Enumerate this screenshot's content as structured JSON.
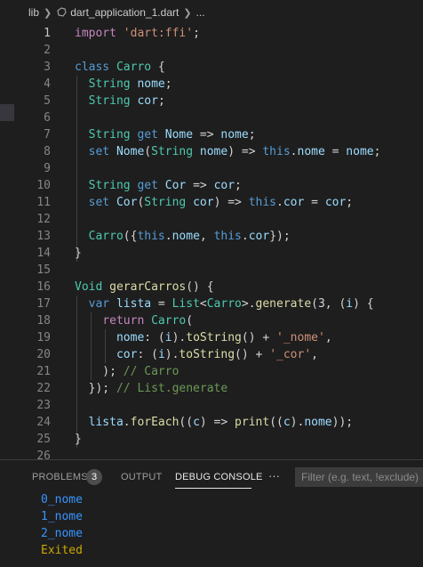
{
  "breadcrumb": {
    "folder": "lib",
    "file": "dart_application_1.dart",
    "tail": "..."
  },
  "lines": [
    {
      "n": "1"
    },
    {
      "n": "2"
    },
    {
      "n": "3"
    },
    {
      "n": "4"
    },
    {
      "n": "5"
    },
    {
      "n": "6"
    },
    {
      "n": "7"
    },
    {
      "n": "8"
    },
    {
      "n": "9"
    },
    {
      "n": "10"
    },
    {
      "n": "11"
    },
    {
      "n": "12"
    },
    {
      "n": "13"
    },
    {
      "n": "14"
    },
    {
      "n": "15"
    },
    {
      "n": "16"
    },
    {
      "n": "17"
    },
    {
      "n": "18"
    },
    {
      "n": "19"
    },
    {
      "n": "20"
    },
    {
      "n": "21"
    },
    {
      "n": "22"
    },
    {
      "n": "23"
    },
    {
      "n": "24"
    },
    {
      "n": "25"
    },
    {
      "n": "26"
    }
  ],
  "code": {
    "l1": [
      [
        "kw2",
        "import"
      ],
      [
        "pl",
        " "
      ],
      [
        "str",
        "'dart:ffi'"
      ],
      [
        "pl",
        ";"
      ]
    ],
    "l3": [
      [
        "kw",
        "class"
      ],
      [
        "pl",
        " "
      ],
      [
        "ty",
        "Carro"
      ],
      [
        "pl",
        " {"
      ]
    ],
    "l4": [
      [
        "pl",
        "  "
      ],
      [
        "ty",
        "String"
      ],
      [
        "pl",
        " "
      ],
      [
        "var",
        "nome"
      ],
      [
        "pl",
        ";"
      ]
    ],
    "l5": [
      [
        "pl",
        "  "
      ],
      [
        "ty",
        "String"
      ],
      [
        "pl",
        " "
      ],
      [
        "var",
        "cor"
      ],
      [
        "pl",
        ";"
      ]
    ],
    "l7": [
      [
        "pl",
        "  "
      ],
      [
        "ty",
        "String"
      ],
      [
        "pl",
        " "
      ],
      [
        "kw",
        "get"
      ],
      [
        "pl",
        " "
      ],
      [
        "var",
        "Nome"
      ],
      [
        "pl",
        " => "
      ],
      [
        "var",
        "nome"
      ],
      [
        "pl",
        ";"
      ]
    ],
    "l8": [
      [
        "pl",
        "  "
      ],
      [
        "kw",
        "set"
      ],
      [
        "pl",
        " "
      ],
      [
        "var",
        "Nome"
      ],
      [
        "pl",
        "("
      ],
      [
        "ty",
        "String"
      ],
      [
        "pl",
        " "
      ],
      [
        "var",
        "nome"
      ],
      [
        "pl",
        ") => "
      ],
      [
        "kw",
        "this"
      ],
      [
        "pl",
        "."
      ],
      [
        "var",
        "nome"
      ],
      [
        "pl",
        " = "
      ],
      [
        "var",
        "nome"
      ],
      [
        "pl",
        ";"
      ]
    ],
    "l10": [
      [
        "pl",
        "  "
      ],
      [
        "ty",
        "String"
      ],
      [
        "pl",
        " "
      ],
      [
        "kw",
        "get"
      ],
      [
        "pl",
        " "
      ],
      [
        "var",
        "Cor"
      ],
      [
        "pl",
        " => "
      ],
      [
        "var",
        "cor"
      ],
      [
        "pl",
        ";"
      ]
    ],
    "l11": [
      [
        "pl",
        "  "
      ],
      [
        "kw",
        "set"
      ],
      [
        "pl",
        " "
      ],
      [
        "var",
        "Cor"
      ],
      [
        "pl",
        "("
      ],
      [
        "ty",
        "String"
      ],
      [
        "pl",
        " "
      ],
      [
        "var",
        "cor"
      ],
      [
        "pl",
        ") => "
      ],
      [
        "kw",
        "this"
      ],
      [
        "pl",
        "."
      ],
      [
        "var",
        "cor"
      ],
      [
        "pl",
        " = "
      ],
      [
        "var",
        "cor"
      ],
      [
        "pl",
        ";"
      ]
    ],
    "l13": [
      [
        "pl",
        "  "
      ],
      [
        "ty",
        "Carro"
      ],
      [
        "pl",
        "({"
      ],
      [
        "kw",
        "this"
      ],
      [
        "pl",
        "."
      ],
      [
        "var",
        "nome"
      ],
      [
        "pl",
        ", "
      ],
      [
        "kw",
        "this"
      ],
      [
        "pl",
        "."
      ],
      [
        "var",
        "cor"
      ],
      [
        "pl",
        "});"
      ]
    ],
    "l14": [
      [
        "pl",
        "}"
      ]
    ],
    "l16": [
      [
        "ty",
        "Void"
      ],
      [
        "pl",
        " "
      ],
      [
        "fn",
        "gerarCarros"
      ],
      [
        "pl",
        "() {"
      ]
    ],
    "l17": [
      [
        "pl",
        "  "
      ],
      [
        "kw",
        "var"
      ],
      [
        "pl",
        " "
      ],
      [
        "var",
        "lista"
      ],
      [
        "pl",
        " = "
      ],
      [
        "ty",
        "List"
      ],
      [
        "pl",
        "<"
      ],
      [
        "ty",
        "Carro"
      ],
      [
        "pl",
        ">."
      ],
      [
        "fn",
        "generate"
      ],
      [
        "pl",
        "(3, ("
      ],
      [
        "var",
        "i"
      ],
      [
        "pl",
        ") {"
      ]
    ],
    "l18": [
      [
        "pl",
        "    "
      ],
      [
        "kw2",
        "return"
      ],
      [
        "pl",
        " "
      ],
      [
        "ty",
        "Carro"
      ],
      [
        "pl",
        "("
      ]
    ],
    "l19": [
      [
        "pl",
        "      "
      ],
      [
        "var",
        "nome"
      ],
      [
        "pl",
        ": ("
      ],
      [
        "var",
        "i"
      ],
      [
        "pl",
        ")."
      ],
      [
        "fn",
        "toString"
      ],
      [
        "pl",
        "() + "
      ],
      [
        "str",
        "'_nome'"
      ],
      [
        "pl",
        ","
      ]
    ],
    "l20": [
      [
        "pl",
        "      "
      ],
      [
        "var",
        "cor"
      ],
      [
        "pl",
        ": ("
      ],
      [
        "var",
        "i"
      ],
      [
        "pl",
        ")."
      ],
      [
        "fn",
        "toString"
      ],
      [
        "pl",
        "() + "
      ],
      [
        "str",
        "'_cor'"
      ],
      [
        "pl",
        ","
      ]
    ],
    "l21": [
      [
        "pl",
        "    ); "
      ],
      [
        "cm",
        "// Carro"
      ]
    ],
    "l22": [
      [
        "pl",
        "  }); "
      ],
      [
        "cm",
        "// List.generate"
      ]
    ],
    "l24": [
      [
        "pl",
        "  "
      ],
      [
        "var",
        "lista"
      ],
      [
        "pl",
        "."
      ],
      [
        "fn",
        "forEach"
      ],
      [
        "pl",
        "(("
      ],
      [
        "var",
        "c"
      ],
      [
        "pl",
        ") => "
      ],
      [
        "fn",
        "print"
      ],
      [
        "pl",
        "(("
      ],
      [
        "var",
        "c"
      ],
      [
        "pl",
        ")."
      ],
      [
        "var",
        "nome"
      ],
      [
        "pl",
        "));"
      ]
    ],
    "l25": [
      [
        "pl",
        "}"
      ]
    ]
  },
  "panel": {
    "tabs": {
      "problems": "PROBLEMS",
      "problems_count": "3",
      "output": "OUTPUT",
      "debug": "DEBUG CONSOLE",
      "more": "···"
    },
    "filter_placeholder": "Filter (e.g. text, !exclude)",
    "console": [
      {
        "text": "0_nome",
        "color": "#3794ff"
      },
      {
        "text": "1_nome",
        "color": "#3794ff"
      },
      {
        "text": "2_nome",
        "color": "#3794ff"
      },
      {
        "text": "Exited",
        "color": "#cca700"
      }
    ]
  }
}
